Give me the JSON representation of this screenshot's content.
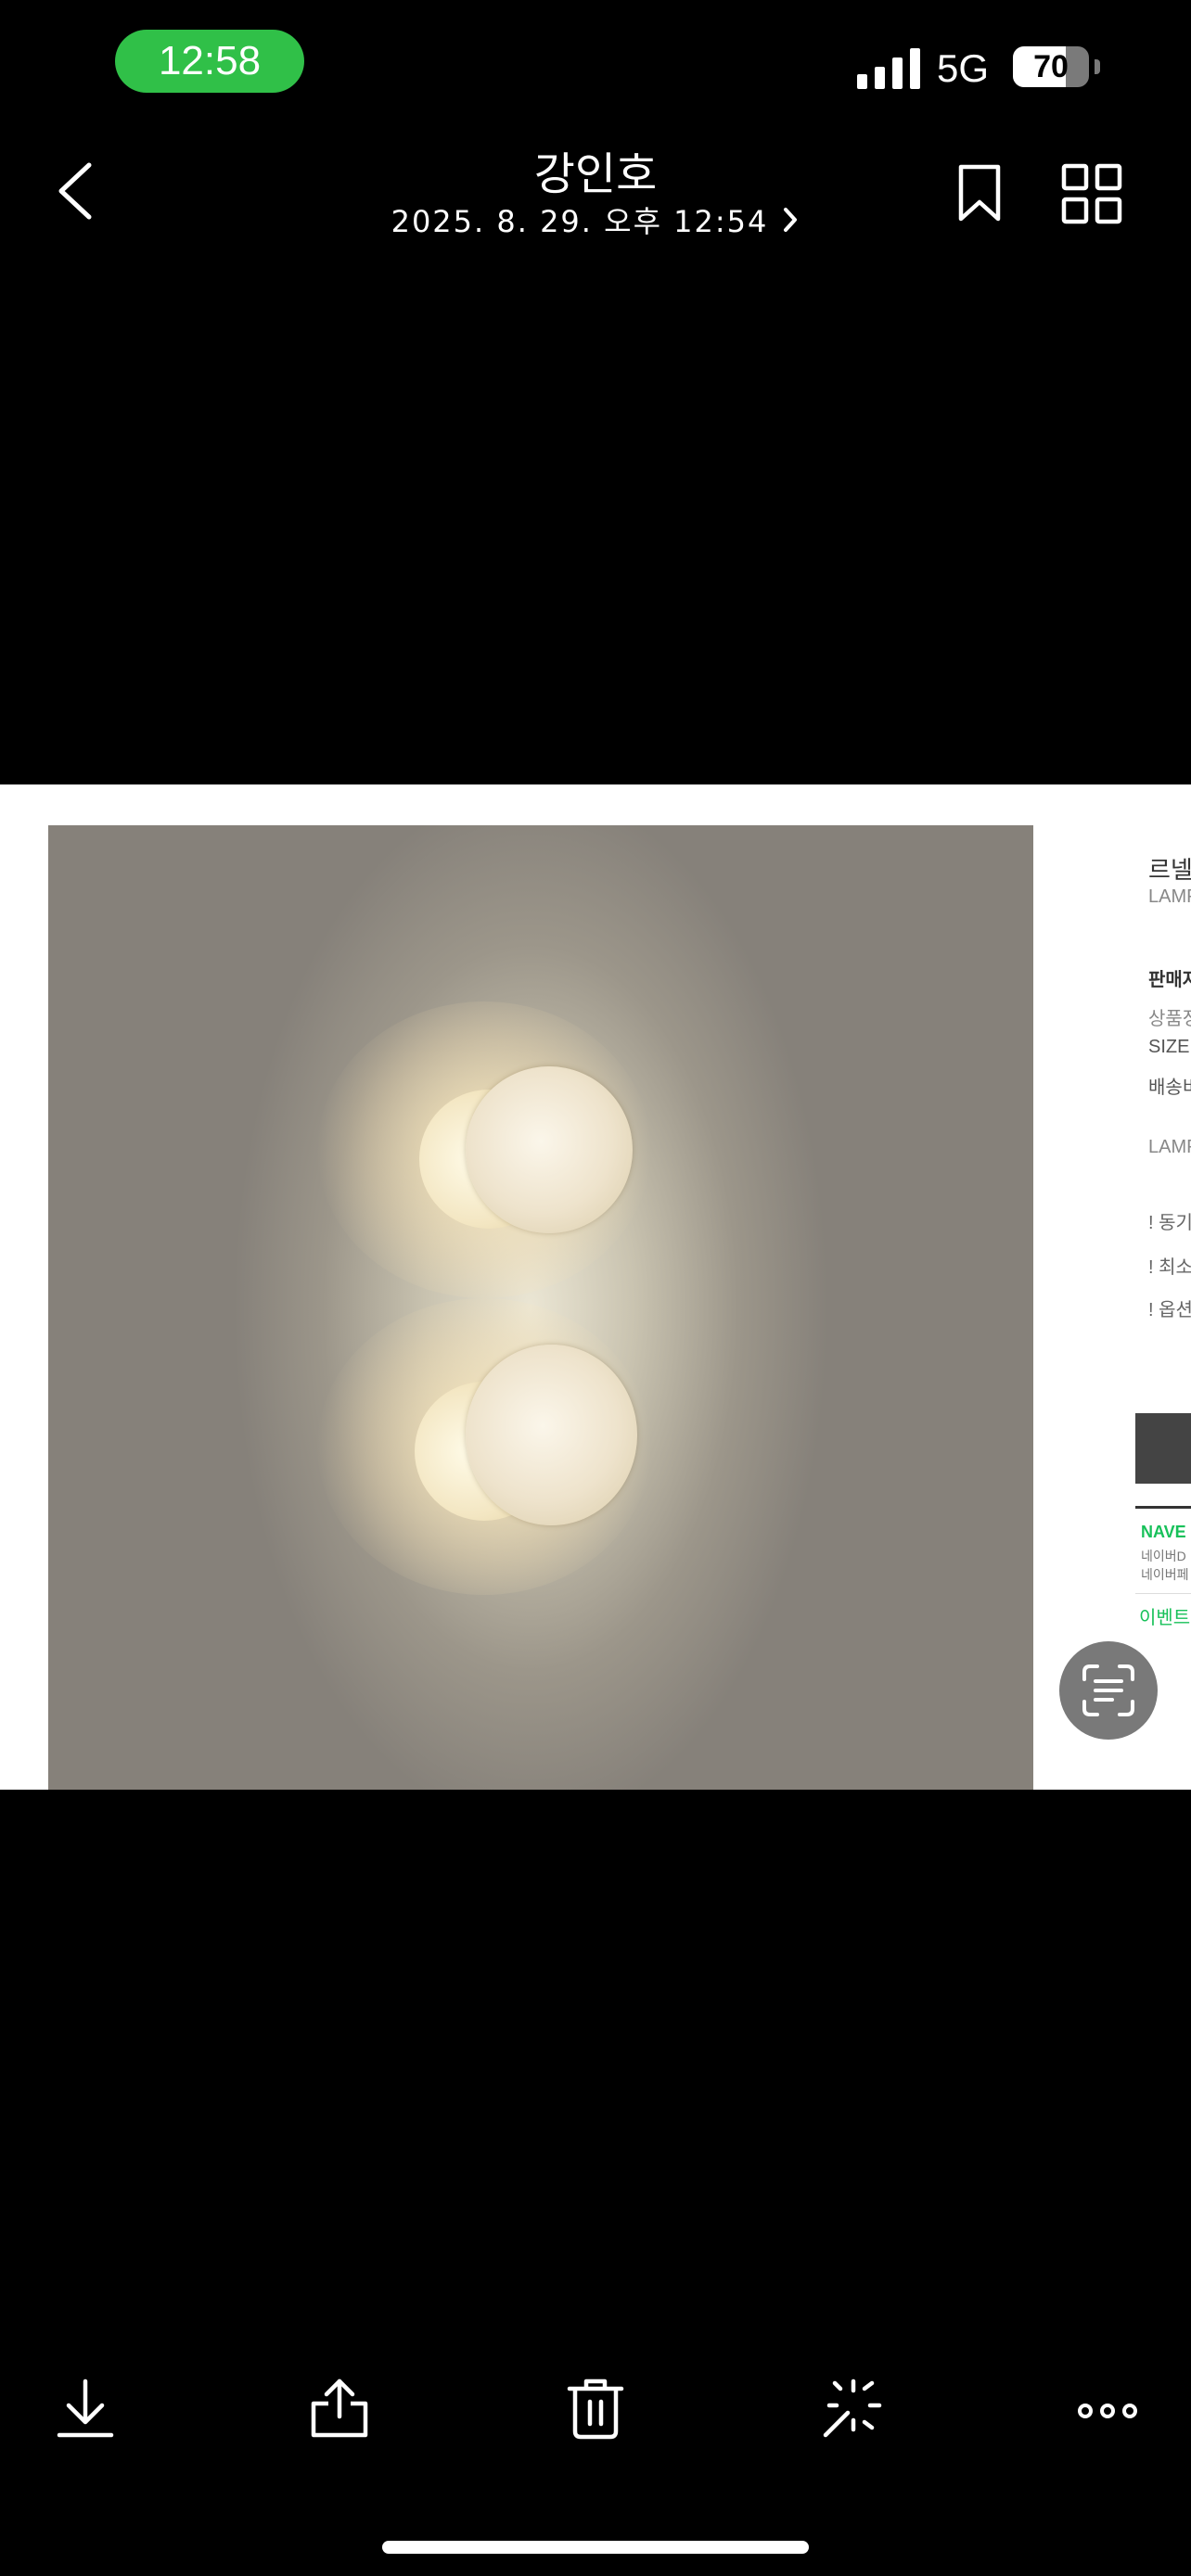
{
  "status_bar": {
    "time": "12:58",
    "network": "5G",
    "battery_level": "70",
    "battery_fraction": 0.7,
    "time_pill_color": "#30c048"
  },
  "header": {
    "title": "강인호",
    "subtitle": "2025. 8. 29. 오후 12:54",
    "back_icon": "chevron-left-icon",
    "subtitle_icon": "chevron-right-icon",
    "bookmark_icon": "bookmark-icon",
    "grid_icon": "grid-icon"
  },
  "photo": {
    "side_page": {
      "title": "르넬",
      "subtitle": "LAMP",
      "seller_label": "판매자",
      "rows": [
        "상품정",
        "SIZE",
        "배송비"
      ],
      "lamp_label": "LAMP",
      "notices": [
        "! 동기",
        "! 최소",
        "! 옵션"
      ],
      "naver": "NAVE",
      "naver_lines": [
        "네이버D",
        "네이버페"
      ],
      "event": "이벤트"
    },
    "live_text_icon": "live-text-scan-icon"
  },
  "toolbar": {
    "icons": [
      "download-icon",
      "share-icon",
      "trash-icon",
      "magic-wand-icon",
      "more-icon"
    ]
  }
}
